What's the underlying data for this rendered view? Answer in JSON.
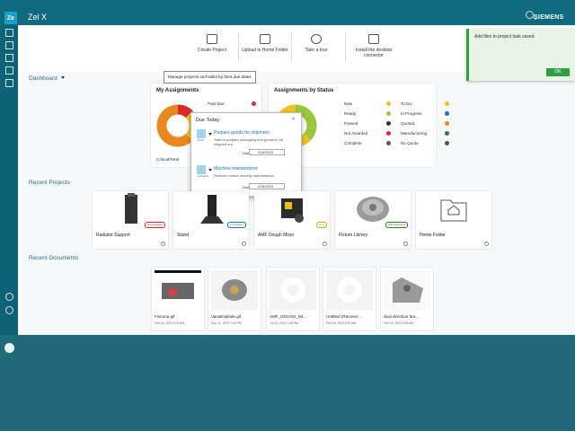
{
  "app": {
    "logo": "Ze",
    "title": "Zel X",
    "brand": "SIEMENS"
  },
  "toolbar": [
    {
      "label": "Create Project",
      "icon": "create-project-icon"
    },
    {
      "label": "Upload to Home Folder",
      "icon": "upload-icon"
    },
    {
      "label": "Take a tour",
      "icon": "play-icon"
    },
    {
      "label": "Install the desktop connector",
      "icon": "install-icon"
    }
  ],
  "toast": {
    "message": "Add files to project task saved.",
    "ok": "OK"
  },
  "dashboard": {
    "label": "Dashboard"
  },
  "tooltip": "Manage projects and tasks by their due dates",
  "my_assignments": {
    "title": "My Assignments",
    "past_due": "Past Due",
    "critical": "Critical/Total",
    "chart_data": {
      "type": "pie",
      "categories": [
        "Past Due",
        "Due Today",
        "Other"
      ],
      "values": [
        1,
        2,
        5
      ],
      "colors": [
        "#d92d2d",
        "#f2c21b",
        "#e8891f"
      ]
    }
  },
  "by_status": {
    "title": "Assignments by Status",
    "col1": [
      {
        "label": "New",
        "count": "0",
        "color": "#f2c21b"
      },
      {
        "label": "Ready",
        "count": "0",
        "color": "#9ac73d"
      },
      {
        "label": "Passed",
        "count": "0",
        "color": "#333333"
      },
      {
        "label": "Not Awarded",
        "count": "0",
        "color": "#d92d2d"
      },
      {
        "label": "Complete",
        "count": "0",
        "color": "#555555"
      }
    ],
    "col2": [
      {
        "label": "To Do",
        "count": "0",
        "color": "#f2c21b"
      },
      {
        "label": "In Progress",
        "count": "0",
        "color": "#1a75a8"
      },
      {
        "label": "Quoted",
        "count": "0",
        "color": "#e8891f"
      },
      {
        "label": "Manufacturing",
        "count": "0",
        "color": "#2e7d32"
      },
      {
        "label": "No Quote",
        "count": "0",
        "color": "#555555"
      }
    ],
    "chart_data": {
      "type": "pie",
      "categories": [
        "Ready",
        "To Do"
      ],
      "values": [
        3,
        5
      ],
      "colors": [
        "#9ac73d",
        "#f2c21b"
      ]
    }
  },
  "due_today": {
    "title": "Due Today",
    "tasks": [
      {
        "name": "Prepare goods for shipment",
        "status": "To Do",
        "desc": "Start to prepare packaging and goods to be shipped out",
        "due_label": "Due",
        "date": "2/16/2023"
      },
      {
        "name": "Machine maintenance",
        "status": "In Progress",
        "desc": "Perform routine monthly maintenance",
        "due_label": "Due",
        "date": "2/16/2023"
      }
    ]
  },
  "recent_projects": {
    "title": "Recent Projects",
    "items": [
      {
        "name": "Radiator Support",
        "badge": "Not Awarded",
        "badge_color": "#d92d2d"
      },
      {
        "name": "Stand",
        "badge": "In Progress",
        "badge_color": "#1a75a8"
      },
      {
        "name": "AMF Dough Mixer",
        "badge": "New",
        "badge_color": "#d4a017"
      },
      {
        "name": "Fixture Library",
        "badge": "Manufacturing",
        "badge_color": "#2e7d32"
      },
      {
        "name": "Home Folder",
        "badge": "",
        "badge_color": "#ffffff"
      }
    ]
  },
  "recent_documents": {
    "title": "Recent Documents",
    "items": [
      {
        "name": "Fixmma.gif",
        "date": "Feb 16, 2023 8:00 AM"
      },
      {
        "name": "VanaExplode.gif",
        "date": "Sep 12, 2022 7:00 PM"
      },
      {
        "name": "AMF_DOUGH_MI...",
        "date": "Jul 20, 2022 1:08 PM"
      },
      {
        "name": "Untitled (Recover...",
        "date": "Feb 16, 2023 9:00 AM"
      },
      {
        "name": "dual direction bra...",
        "date": "Feb 16, 2023 8:05 AM"
      }
    ]
  }
}
